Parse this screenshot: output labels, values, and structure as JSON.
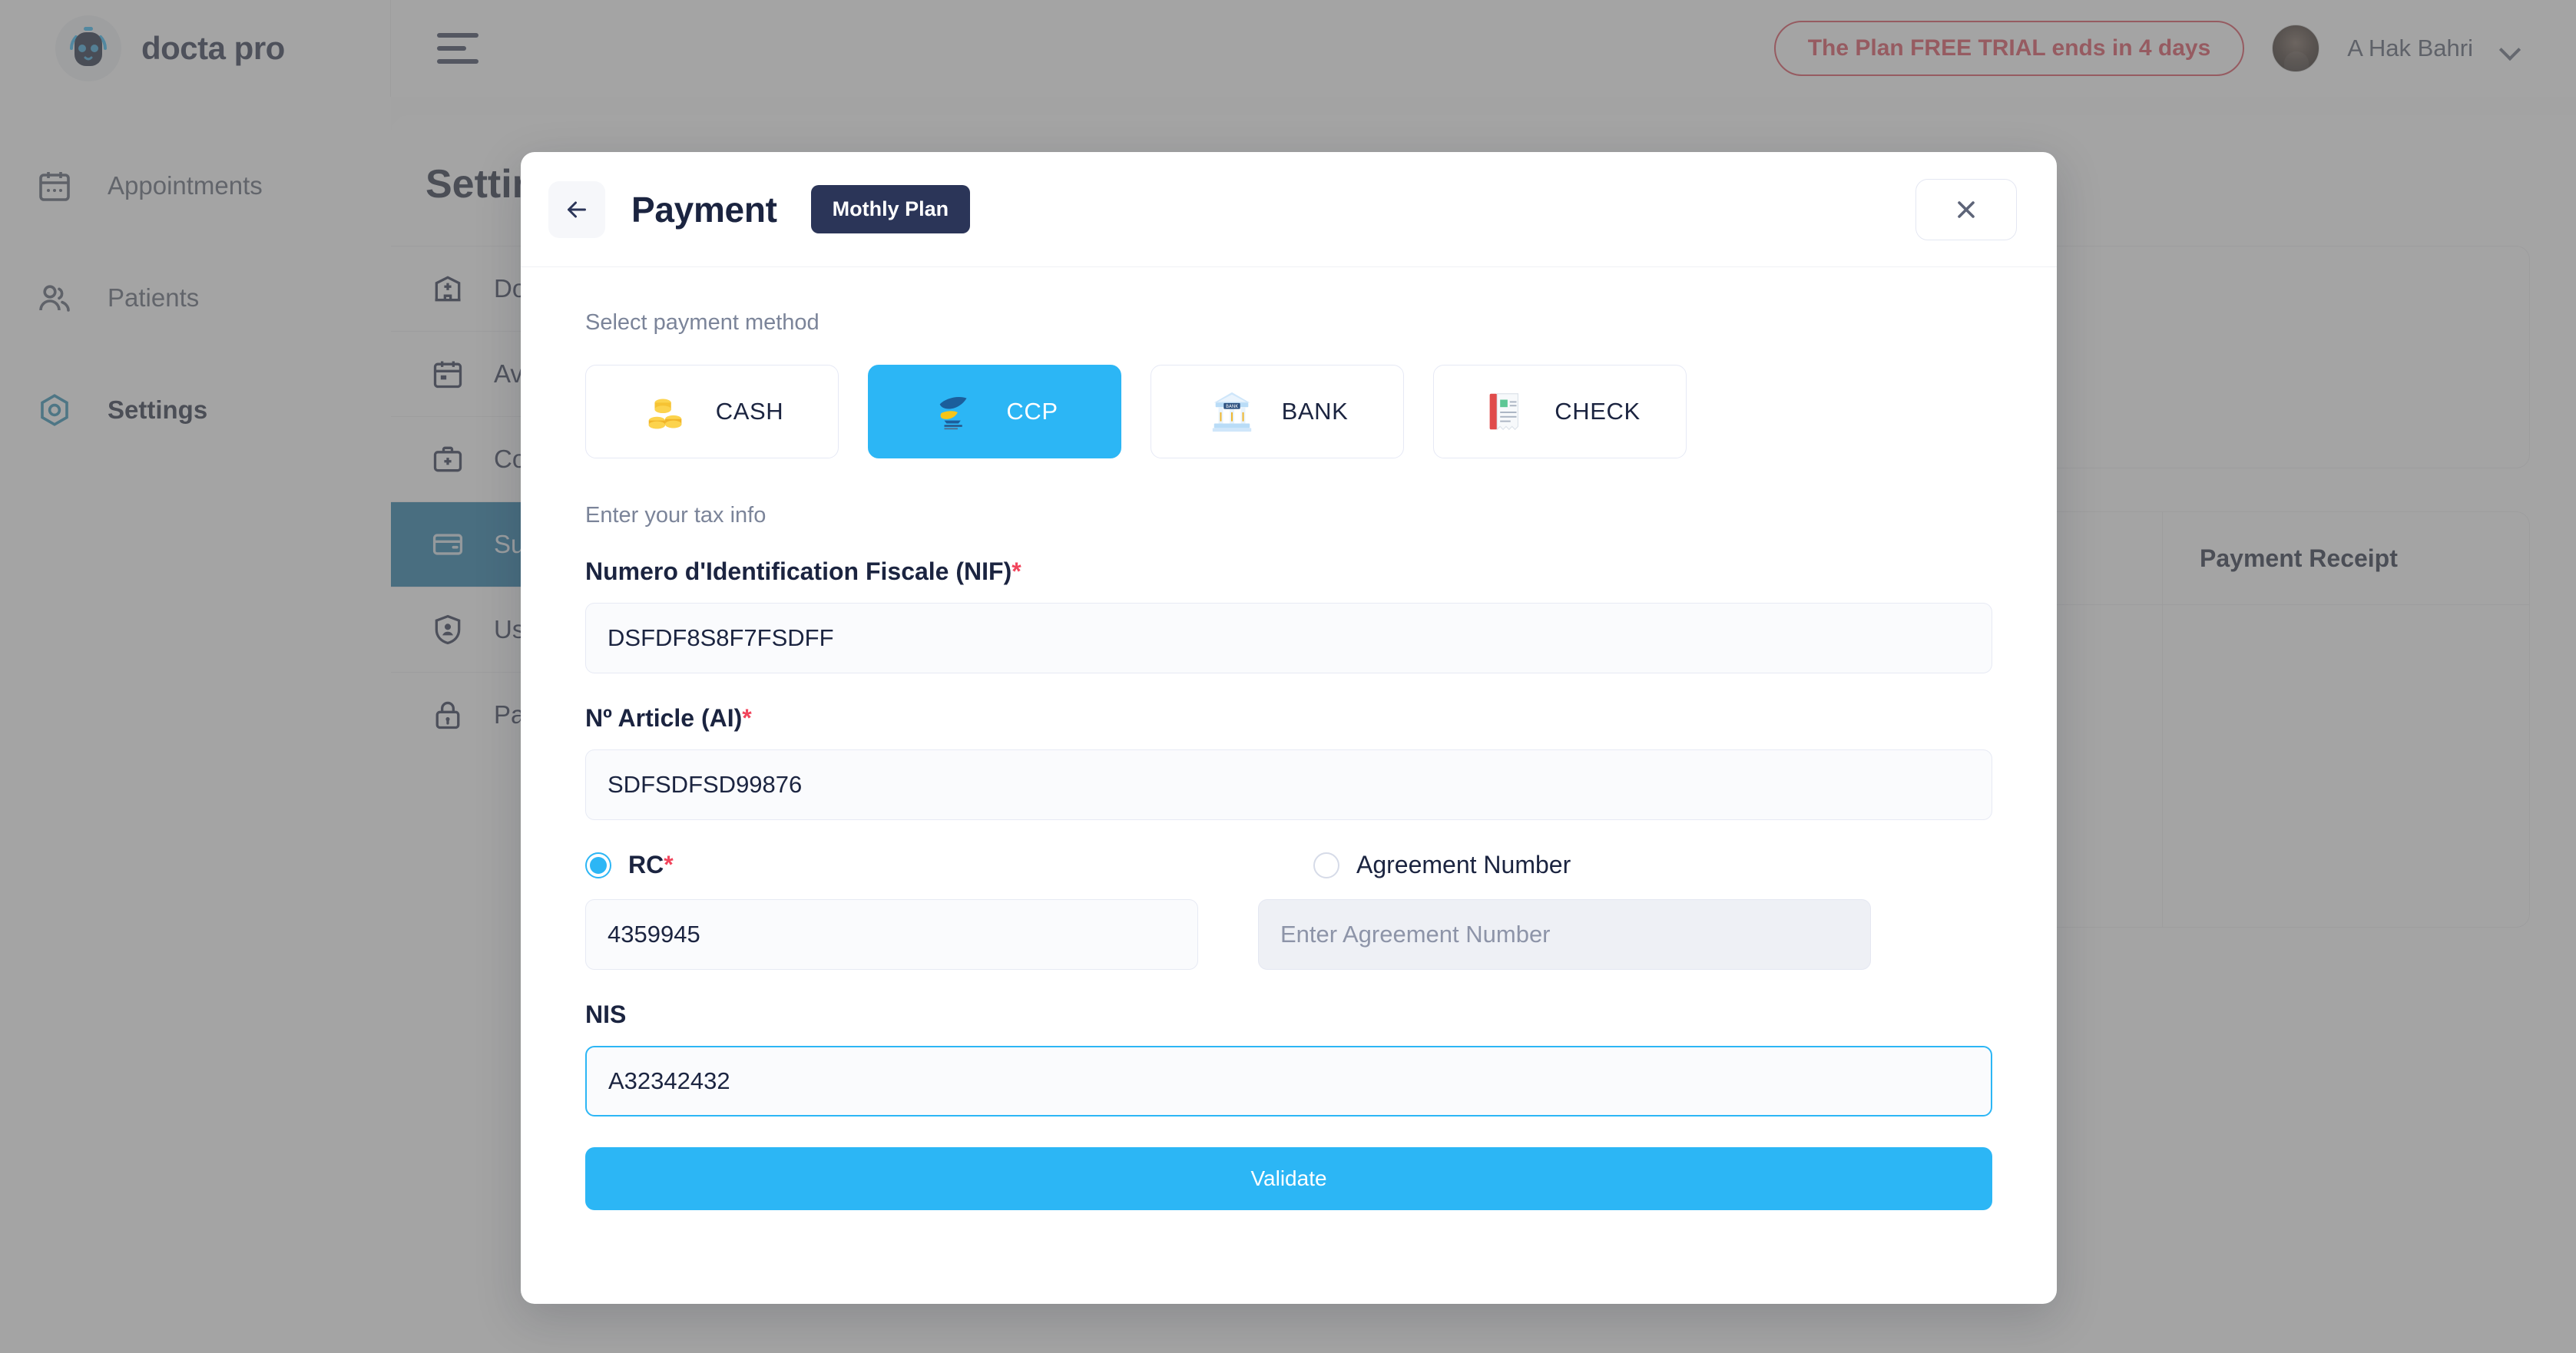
{
  "brand": {
    "name": "docta pro",
    "logo_icon": "robot-face-icon"
  },
  "topbar": {
    "menu_icon": "hamburger-menu-icon",
    "trial_notice": "The Plan FREE TRIAL ends in 4 days",
    "user_name": "A Hak Bahri",
    "caret_icon": "chevron-down-icon",
    "avatar_icon": "user-avatar"
  },
  "sidebar": {
    "items": [
      {
        "label": "Appointments",
        "icon": "calendar-icon",
        "active": false
      },
      {
        "label": "Patients",
        "icon": "users-icon",
        "active": false
      },
      {
        "label": "Settings",
        "icon": "hexagon-gear-icon",
        "active": true
      }
    ]
  },
  "page": {
    "title": "Settings",
    "settings_items": [
      {
        "label": "Doc",
        "icon": "hospital-icon",
        "active": false
      },
      {
        "label": "Ava",
        "icon": "calendar-icon",
        "active": false
      },
      {
        "label": "Con",
        "icon": "medical-bag-icon",
        "active": false
      },
      {
        "label": "Sub",
        "icon": "credit-card-icon",
        "active": true
      },
      {
        "label": "Use",
        "icon": "shield-user-icon",
        "active": false
      },
      {
        "label": "Pas",
        "icon": "lock-icon",
        "active": false
      }
    ],
    "table": {
      "columns": [
        "",
        "",
        "",
        "Payment Receipt"
      ]
    }
  },
  "modal": {
    "back_icon": "arrow-left-icon",
    "title": "Payment",
    "plan_badge": "Mothly Plan",
    "close_icon": "close-icon",
    "payment_method_label": "Select payment method",
    "methods": [
      {
        "label": "CASH",
        "icon": "coins-icon",
        "selected": false
      },
      {
        "label": "CCP",
        "icon": "algerie-poste-icon",
        "selected": true
      },
      {
        "label": "BANK",
        "icon": "bank-icon",
        "selected": false
      },
      {
        "label": "CHECK",
        "icon": "receipt-icon",
        "selected": false
      }
    ],
    "tax_info_label": "Enter your tax info",
    "fields": {
      "nif": {
        "label": "Numero d'Identification Fiscale (NIF)",
        "required_mark": "*",
        "value": "DSFDF8S8F7FSDFF"
      },
      "article": {
        "label": "Nº Article (AI)",
        "required_mark": "*",
        "value": "SDFSDFSD99876"
      },
      "rc": {
        "label": "RC",
        "required_mark": "*",
        "value": "4359945",
        "selected": true
      },
      "agreement": {
        "label": "Agreement Number",
        "placeholder": "Enter Agreement Number",
        "value": "",
        "selected": false
      },
      "nis": {
        "label": "NIS",
        "value": "A32342432",
        "focused": true
      }
    },
    "validate_label": "Validate"
  },
  "colors": {
    "accent_cyan": "#2cb6f5",
    "navy": "#2b3558",
    "danger_red": "#d9414f",
    "required_red": "#f1455c",
    "active_blue": "#1171a1"
  }
}
